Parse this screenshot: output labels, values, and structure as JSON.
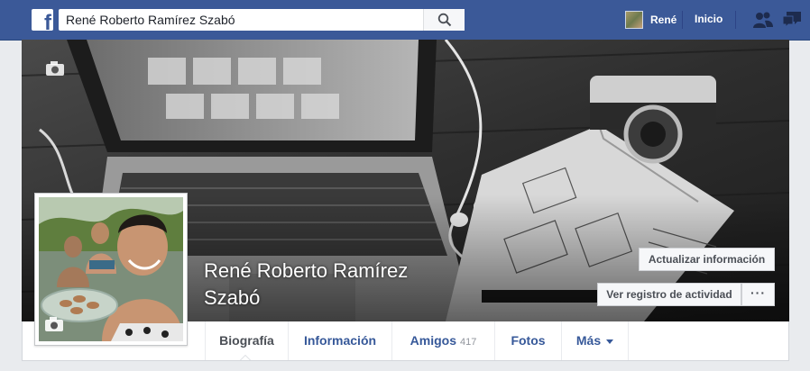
{
  "topbar": {
    "search_value": "René Roberto Ramírez Szabó",
    "user_name": "René",
    "home_label": "Inicio",
    "brand_color": "#3b5998"
  },
  "profile": {
    "name": "René Roberto Ramírez Szabó"
  },
  "actions": {
    "update_info": "Actualizar información",
    "activity_log": "Ver registro de actividad",
    "more": "···"
  },
  "tabs": [
    {
      "label": "Biografía",
      "active": true
    },
    {
      "label": "Información"
    },
    {
      "label": "Amigos",
      "count": "417"
    },
    {
      "label": "Fotos"
    },
    {
      "label": "Más"
    }
  ],
  "icons": {
    "logo": "facebook-logo-icon",
    "search": "search-icon",
    "friends": "friend-requests-icon",
    "messages": "messages-icon",
    "camera": "camera-icon",
    "dropdown": "caret-down-icon"
  }
}
